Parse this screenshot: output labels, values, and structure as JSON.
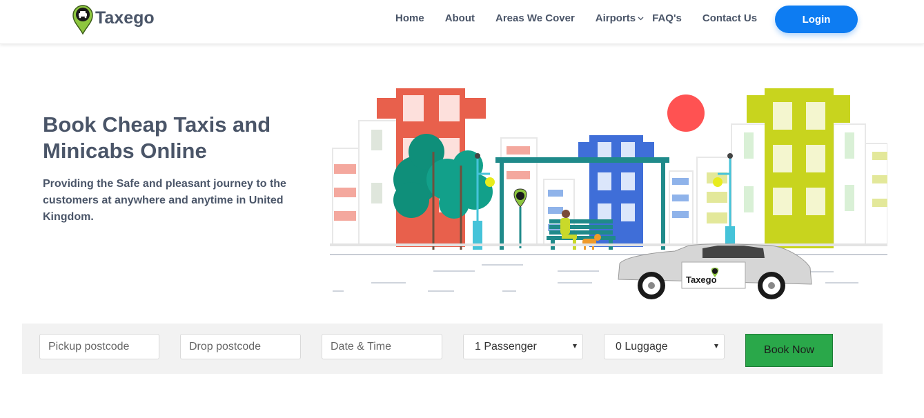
{
  "header": {
    "brand": "Taxego",
    "nav": [
      {
        "label": "Home"
      },
      {
        "label": "About"
      },
      {
        "label": "Areas We Cover"
      },
      {
        "label": "Airports"
      },
      {
        "label": "FAQ's"
      },
      {
        "label": "Contact Us"
      }
    ],
    "login_label": "Login"
  },
  "hero": {
    "title": "Book Cheap Taxis and Minicabs Online",
    "subtitle": "Providing the Safe and pleasant journey to the customers at anywhere and anytime in United Kingdom.",
    "car_brand_text": "Taxego"
  },
  "booking": {
    "pickup_placeholder": "Pickup postcode",
    "drop_placeholder": "Drop postcode",
    "datetime_placeholder": "Date & Time",
    "passenger_selected": "1 Passenger",
    "luggage_selected": "0 Luggage",
    "book_label": "Book Now"
  },
  "colors": {
    "accent": "#0d7cf2",
    "book_green": "#2aa84a",
    "text": "#4a5568",
    "logo_green": "#8dc63f"
  }
}
